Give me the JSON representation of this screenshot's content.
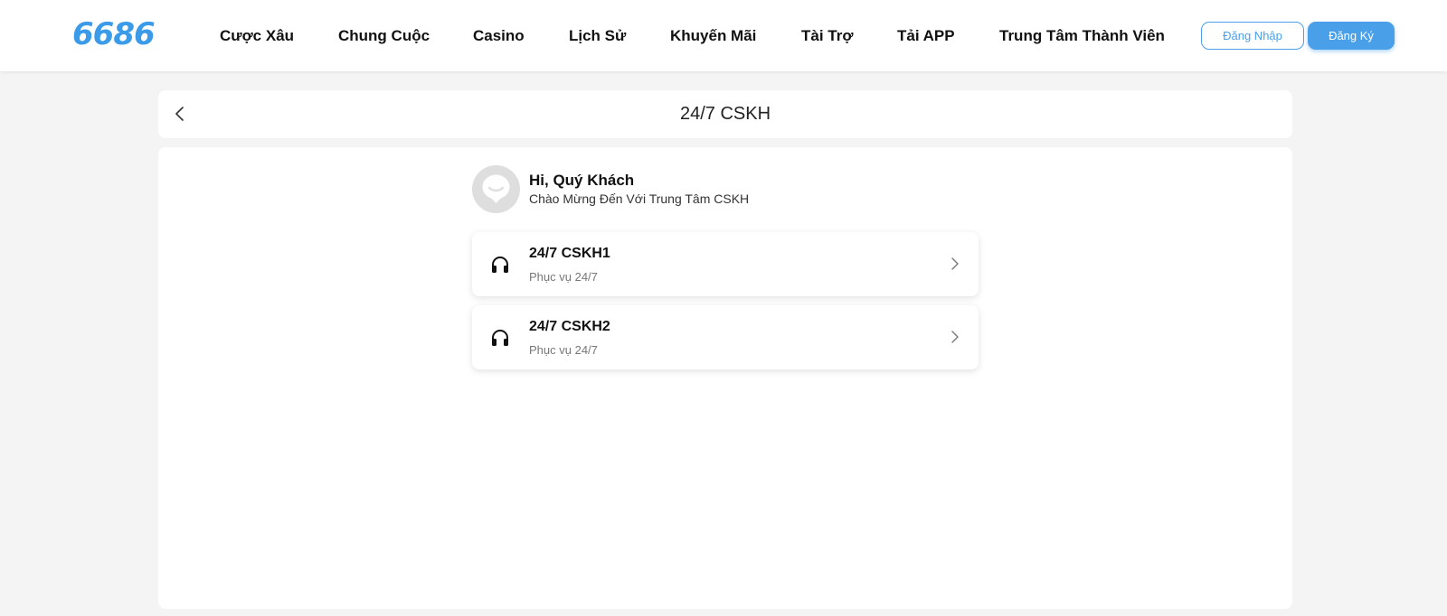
{
  "header": {
    "logo": "6686",
    "nav": [
      {
        "label": "Cược Xâu"
      },
      {
        "label": "Chung Cuộc"
      },
      {
        "label": "Casino"
      },
      {
        "label": "Lịch Sử"
      },
      {
        "label": "Khuyến Mãi"
      },
      {
        "label": "Tài Trợ"
      },
      {
        "label": "Tải APP"
      },
      {
        "label": "Trung Tâm Thành Viên"
      }
    ],
    "login_label": "Đăng Nhập",
    "register_label": "Đăng Ký"
  },
  "titlebar": {
    "title": "24/7 CSKH",
    "back_icon": "chevron-left-icon"
  },
  "greeting": {
    "avatar_icon": "chat-bubble-icon",
    "title": "Hi, Quý Khách",
    "subtitle": "Chào Mừng Đến Với Trung Tâm CSKH"
  },
  "services": [
    {
      "name": "24/7 CSKH1",
      "subtitle": "Phục vụ 24/7",
      "icon": "headset-icon"
    },
    {
      "name": "24/7 CSKH2",
      "subtitle": "Phục vụ 24/7",
      "icon": "headset-icon"
    }
  ],
  "colors": {
    "brand": "#3c9be8",
    "button": "#4a9fe9",
    "background": "#f4f4f4",
    "avatar": "#dedede"
  }
}
